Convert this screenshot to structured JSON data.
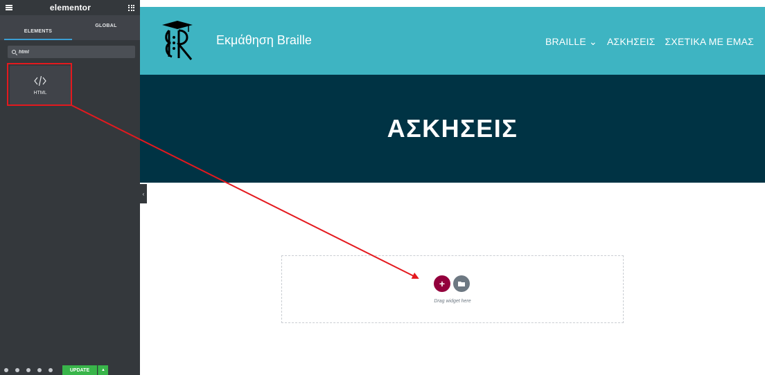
{
  "editor": {
    "logo_text": "elementor",
    "tabs": [
      {
        "label": "ELEMENTS",
        "active": true
      },
      {
        "label": "GLOBAL",
        "active": false
      }
    ],
    "search": {
      "value": "html",
      "placeholder": "Search Widget..."
    },
    "widgets": [
      {
        "label": "HTML",
        "icon": "code-icon"
      }
    ],
    "footer": {
      "update_label": "UPDATE"
    },
    "accent_color": "#39b54a"
  },
  "site": {
    "title": "Εκμάθηση Braille",
    "nav": [
      {
        "label": "BRAILLE ⌄"
      },
      {
        "label": "ΑΣΚΗΣΕΙΣ"
      },
      {
        "label": "ΣΧΕΤΙΚΑ ΜΕ ΕΜΑΣ"
      }
    ],
    "hero_title": "ΑΣΚΗΣΕΙΣ",
    "header_color": "#3eb4c2",
    "hero_color": "#003344"
  },
  "dropzone": {
    "hint": "Drag widget here",
    "add_symbol": "+"
  },
  "annotation": {
    "color": "#e4191e"
  }
}
